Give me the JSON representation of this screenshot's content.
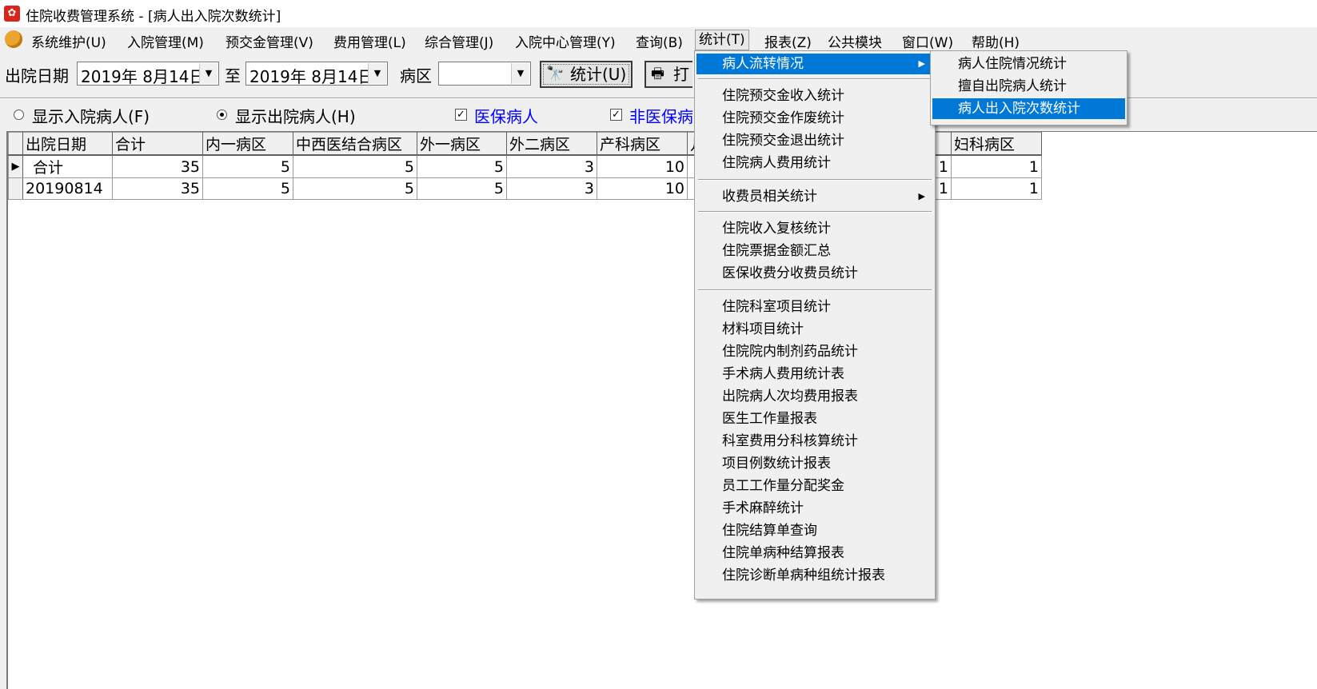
{
  "window": {
    "title": "住院收费管理系统 - [病人出入院次数统计]"
  },
  "menubar": {
    "items": [
      "系统维护(U)",
      "入院管理(M)",
      "预交金管理(V)",
      "费用管理(L)",
      "综合管理(J)",
      "入院中心管理(Y)",
      "查询(B)",
      "统计(T)",
      "报表(Z)",
      "公共模块",
      "窗口(W)",
      "帮助(H)"
    ]
  },
  "toolbar": {
    "discharge_date_label": "出院日期",
    "date_from": "2019年 8月14日",
    "to_label": "至",
    "date_to": "2019年 8月14日",
    "ward_label": "病区",
    "ward_value": "",
    "stat_button": "统计(U)",
    "print_button": "打"
  },
  "options": {
    "show_admitted": "显示入院病人(F)",
    "show_discharged": "显示出院病人(H)",
    "insured": "医保病人",
    "non_insured": "非医保病"
  },
  "grid": {
    "columns": [
      "出院日期",
      "合计",
      "内一病区",
      "中西医结合病区",
      "外一病区",
      "外二病区",
      "产科病区",
      "儿",
      "妇科病区"
    ],
    "rows": [
      {
        "indicator": "▶",
        "cells": [
          "合计",
          "35",
          "5",
          "5",
          "5",
          "3",
          "10",
          "1",
          "1"
        ]
      },
      {
        "indicator": "",
        "cells": [
          "20190814",
          "35",
          "5",
          "5",
          "5",
          "3",
          "10",
          "1",
          "1"
        ]
      }
    ]
  },
  "stats_menu": {
    "items": [
      "病人流转情况",
      "住院预交金收入统计",
      "住院预交金作废统计",
      "住院预交金退出统计",
      "住院病人费用统计",
      "收费员相关统计",
      "住院收入复核统计",
      "住院票据金额汇总",
      "医保收费分收费员统计",
      "住院科室项目统计",
      "材料项目统计",
      "住院院内制剂药品统计",
      "手术病人费用统计表",
      "出院病人次均费用报表",
      "医生工作量报表",
      "科室费用分科核算统计",
      "项目例数统计报表",
      "员工工作量分配奖金",
      "手术麻醉统计",
      "住院结算单查询",
      "住院单病种结算报表",
      "住院诊断单病种组统计报表"
    ]
  },
  "submenu": {
    "items": [
      "病人住院情况统计",
      "擅自出院病人统计",
      "病人出入院次数统计"
    ]
  },
  "colors": {
    "highlight": "#0078d7",
    "link_blue": "#0000ff"
  }
}
